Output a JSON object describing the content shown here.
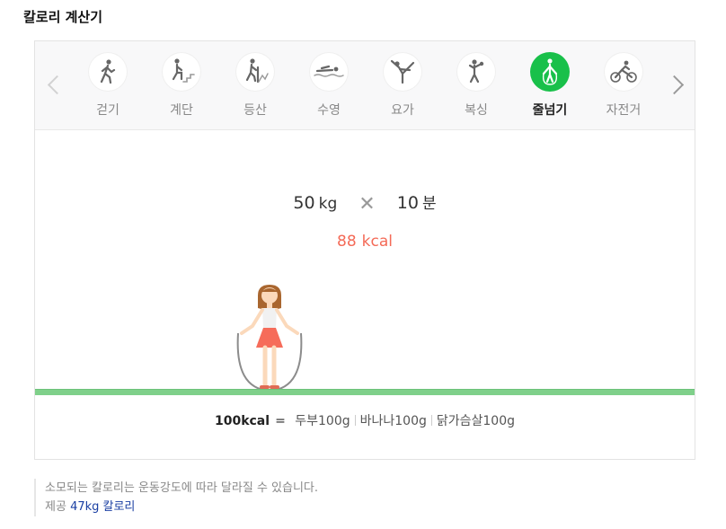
{
  "header": {
    "title": "칼로리 계산기"
  },
  "tabs": [
    {
      "label": "걷기",
      "icon": "walking-icon"
    },
    {
      "label": "계단",
      "icon": "stairs-icon"
    },
    {
      "label": "등산",
      "icon": "hiking-icon"
    },
    {
      "label": "수영",
      "icon": "swimming-icon"
    },
    {
      "label": "요가",
      "icon": "yoga-icon"
    },
    {
      "label": "복싱",
      "icon": "boxing-icon"
    },
    {
      "label": "줄넘기",
      "icon": "jump-rope-icon",
      "active": true
    },
    {
      "label": "자전거",
      "icon": "cycling-icon"
    }
  ],
  "formula": {
    "weight": "50",
    "weight_unit": "kg",
    "minutes": "10",
    "minutes_unit": "분"
  },
  "result": {
    "value": "88",
    "unit": "kcal"
  },
  "equivalents": {
    "base": "100kcal",
    "equals": "=",
    "items": [
      "두부100g",
      "바나나100g",
      "닭가슴살100g"
    ]
  },
  "footnote": {
    "note": "소모되는 칼로리는 운동강도에 따라 달라질 수 있습니다.",
    "source_prefix": "제공",
    "source_name": "47kg 칼로리"
  },
  "colors": {
    "active_green": "#19c04a",
    "result_red": "#f46a57",
    "ground_green": "#7fd08a",
    "link_blue": "#1a3fa3"
  }
}
